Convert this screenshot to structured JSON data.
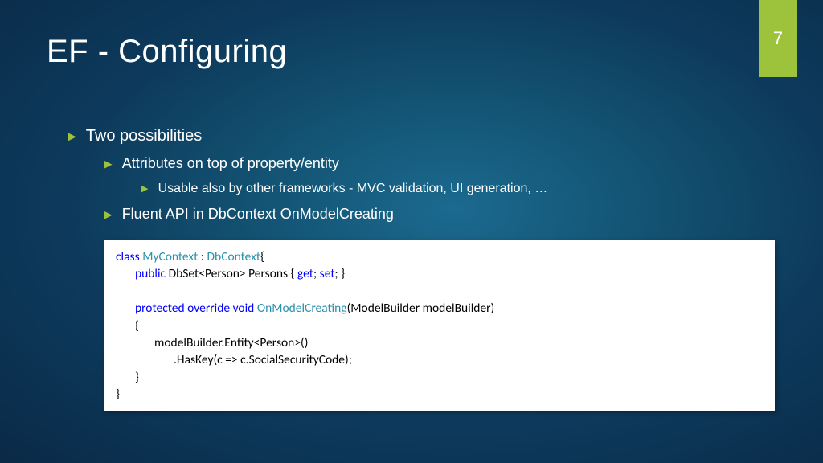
{
  "pageNumber": "7",
  "title": "EF - Configuring",
  "bullets": {
    "b1": "Two possibilities",
    "b2": "Attributes on top of property/entity",
    "b3": "Usable also by other frameworks - MVC validation, UI generation, …",
    "b4": "Fluent API in DbContext OnModelCreating"
  },
  "code": {
    "kw_class": "class",
    "type_mycontext": "MyContext",
    "colon_space": " : ",
    "type_dbcontext": "DbContext",
    "brace_open": "{",
    "kw_public": "public",
    "dbset_persons": " DbSet<Person> Persons { ",
    "kw_get": "get",
    "semi1": "; ",
    "kw_set": "set",
    "semi_brace": "; }",
    "blank": " ",
    "kw_protected": "protected",
    "sp1": " ",
    "kw_override": "override",
    "sp2": " ",
    "kw_void": "void",
    "sp3": " ",
    "type_onmodel": "OnModelCreating",
    "sig_rest": "(ModelBuilder modelBuilder)",
    "brace_open2": "{",
    "line_entity": "modelBuilder.Entity<Person>()",
    "line_haskey": ".HasKey(c => c.SocialSecurityCode);",
    "brace_close2": "}",
    "brace_close1": "}"
  }
}
